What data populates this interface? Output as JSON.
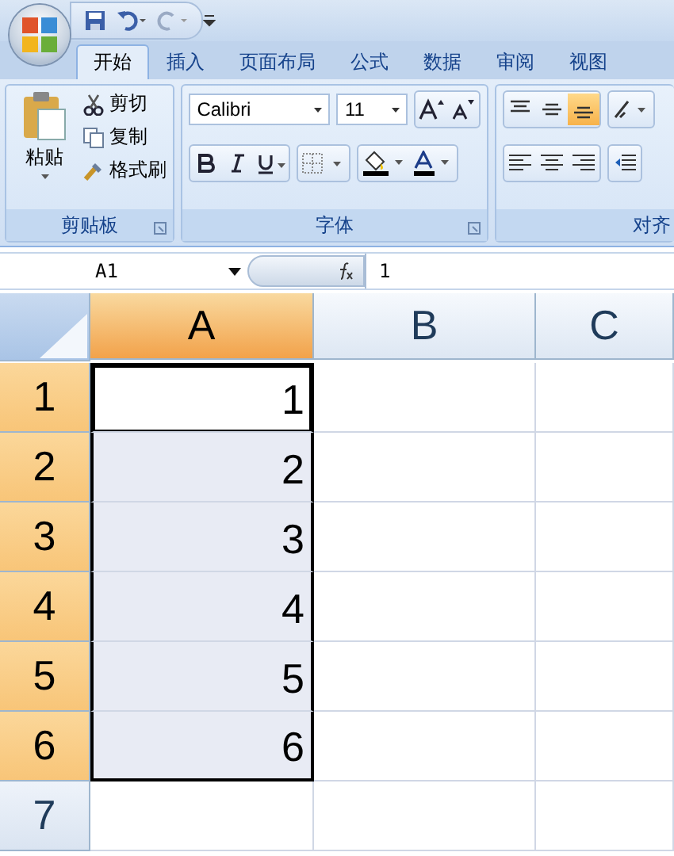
{
  "tabs": [
    {
      "label": "开始",
      "selected": true
    },
    {
      "label": "插入",
      "selected": false
    },
    {
      "label": "页面布局",
      "selected": false
    },
    {
      "label": "公式",
      "selected": false
    },
    {
      "label": "数据",
      "selected": false
    },
    {
      "label": "审阅",
      "selected": false
    },
    {
      "label": "视图",
      "selected": false
    }
  ],
  "clipboard": {
    "paste": "粘贴",
    "cut": "剪切",
    "copy": "复制",
    "format_painter": "格式刷",
    "label": "剪贴板"
  },
  "font": {
    "name": "Calibri",
    "size": "11",
    "label": "字体"
  },
  "alignment": {
    "label": "对齐",
    "vertical": [
      {
        "selected": false
      },
      {
        "selected": false
      },
      {
        "selected": true
      }
    ]
  },
  "name_box": "A1",
  "formula": "1",
  "columns": [
    {
      "label": "A",
      "selected": true
    },
    {
      "label": "B",
      "selected": false
    },
    {
      "label": "C",
      "selected": false
    }
  ],
  "rows": [
    {
      "header": "1",
      "selected": true,
      "active": true,
      "value": "1"
    },
    {
      "header": "2",
      "selected": true,
      "active": false,
      "value": "2"
    },
    {
      "header": "3",
      "selected": true,
      "active": false,
      "value": "3"
    },
    {
      "header": "4",
      "selected": true,
      "active": false,
      "value": "4"
    },
    {
      "header": "5",
      "selected": true,
      "active": false,
      "value": "5"
    },
    {
      "header": "6",
      "selected": true,
      "active": false,
      "value": "6"
    },
    {
      "header": "7",
      "selected": false,
      "active": false
    }
  ]
}
